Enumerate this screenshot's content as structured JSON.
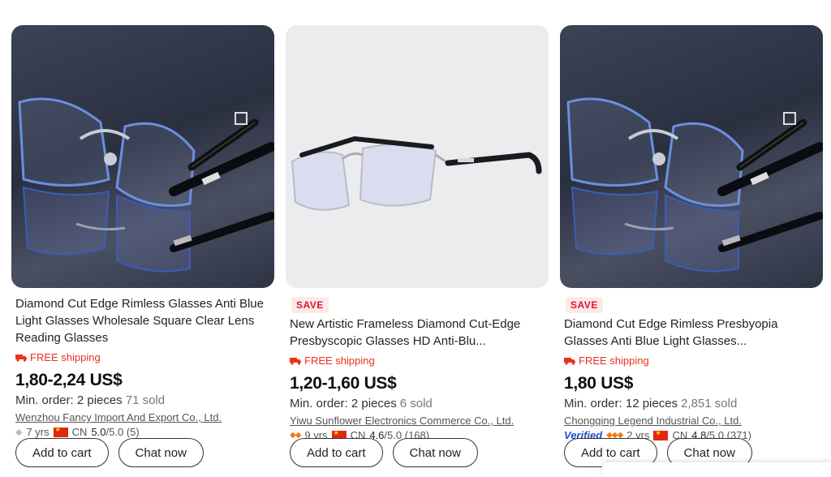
{
  "products": [
    {
      "title": "Diamond Cut Edge Rimless Glasses Anti Blue Light Glasses Wholesale Square Clear Lens Reading Glasses",
      "badge": "",
      "shipping": "FREE shipping",
      "price": "1,80-2,24 US$",
      "min_order": "Min. order: 2 pieces",
      "sold": "71 sold",
      "supplier": "Wenzhou Fancy Import And Export Co., Ltd.",
      "years": "7 yrs",
      "country": "CN",
      "rating": "5.0",
      "rating_of": "/5.0",
      "reviews": "(5)",
      "verified": "",
      "buttons": [
        "Add to cart",
        "Chat now"
      ]
    },
    {
      "title": "New Artistic Frameless Diamond Cut-Edge Presbyscopic Glasses HD Anti-Blu...",
      "badge": "SAVE",
      "shipping": "FREE shipping",
      "price": "1,20-1,60 US$",
      "min_order": "Min. order: 2 pieces",
      "sold": "6 sold",
      "supplier": "Yiwu Sunflower Electronics Commerce Co., Ltd.",
      "years": "9 yrs",
      "country": "CN",
      "rating": "4.6",
      "rating_of": "/5.0",
      "reviews": "(168)",
      "verified": "",
      "buttons": [
        "Add to cart",
        "Chat now"
      ]
    },
    {
      "title": "Diamond Cut Edge Rimless Presbyopia Glasses Anti Blue Light Glasses...",
      "badge": "SAVE",
      "shipping": "FREE shipping",
      "price": "1,80 US$",
      "min_order": "Min. order: 12 pieces",
      "sold": "2,851 sold",
      "supplier": "Chongqing Legend Industrial Co., Ltd.",
      "years": "2 yrs",
      "country": "CN",
      "rating": "4.8",
      "rating_of": "/5.0",
      "reviews": "(371)",
      "verified": "Verified",
      "buttons": [
        "Add to cart",
        "Chat now"
      ]
    }
  ],
  "colors": {
    "accent": "#e8321e",
    "save_badge": "#d8192e",
    "verified": "#1b54c7"
  }
}
